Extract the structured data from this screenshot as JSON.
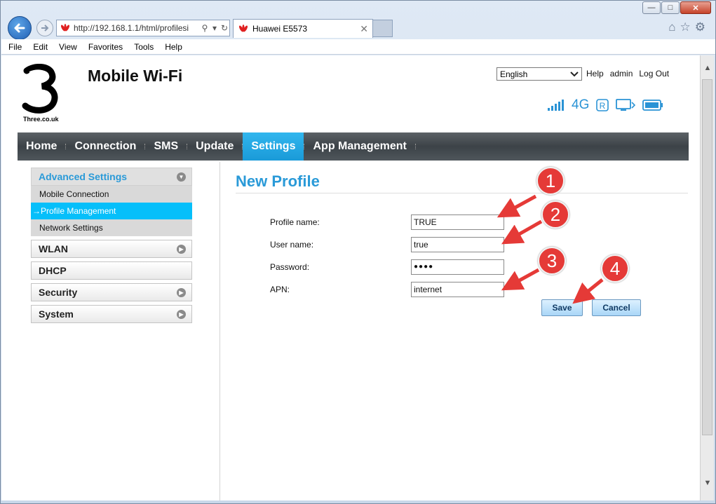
{
  "browser": {
    "address_url": "http://192.168.1.1/html/profilesi",
    "tab_title": "Huawei E5573",
    "menu": [
      "File",
      "Edit",
      "View",
      "Favorites",
      "Tools",
      "Help"
    ]
  },
  "header": {
    "site_label": "Three.co.uk",
    "title": "Mobile Wi-Fi",
    "language_selected": "English",
    "links": [
      "Help",
      "admin",
      "Log Out"
    ],
    "network_type": "4G"
  },
  "nav": {
    "items": [
      "Home",
      "Connection",
      "SMS",
      "Update",
      "Settings",
      "App Management"
    ],
    "active": "Settings"
  },
  "sidebar": {
    "advanced": "Advanced Settings",
    "sub_items": [
      "Mobile Connection",
      "Profile Management",
      "Network Settings"
    ],
    "groups": [
      "WLAN",
      "DHCP",
      "Security",
      "System"
    ]
  },
  "form": {
    "title": "New Profile",
    "fields": [
      {
        "label": "Profile name:",
        "value": "TRUE"
      },
      {
        "label": "User name:",
        "value": "true"
      },
      {
        "label": "Password:",
        "value": "●●●●"
      },
      {
        "label": "APN:",
        "value": "internet"
      }
    ],
    "save": "Save",
    "cancel": "Cancel"
  },
  "callouts": [
    "1",
    "2",
    "3",
    "4"
  ],
  "colors": {
    "accent": "#2a9ad8",
    "active_nav": "#1fa8e4",
    "callout": "#e53a37"
  }
}
